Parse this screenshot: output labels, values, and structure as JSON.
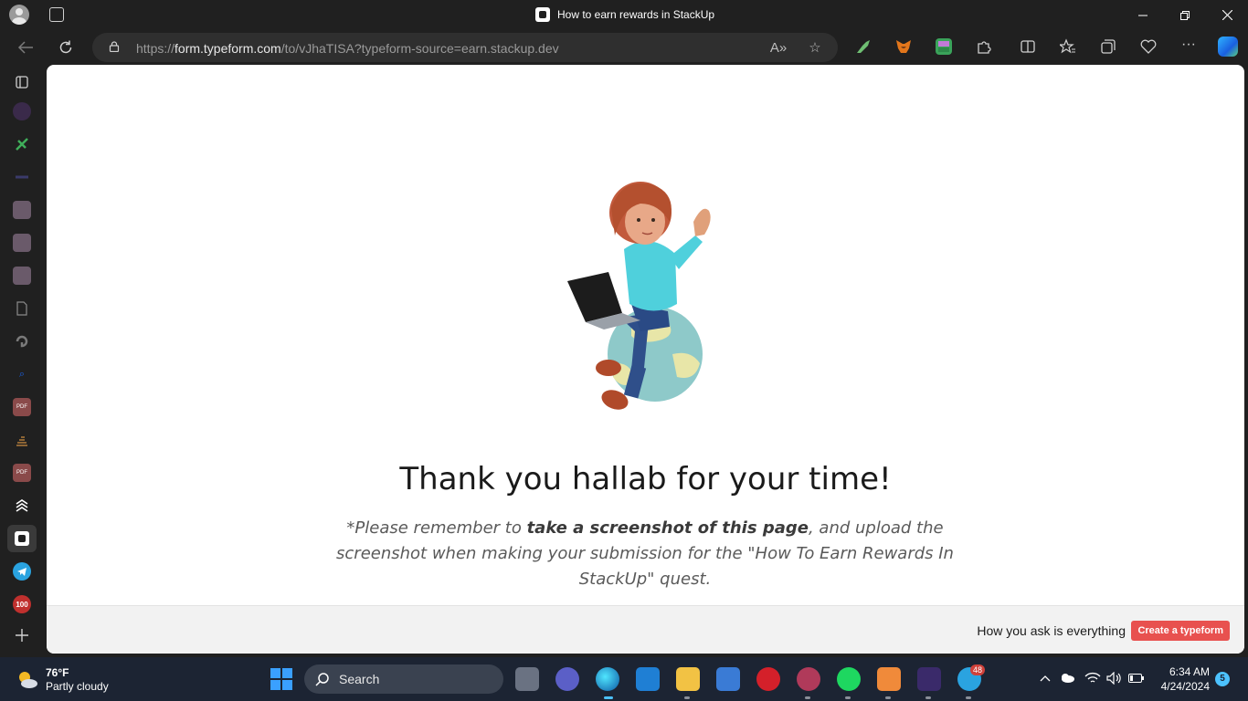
{
  "browser": {
    "tab_title": "How to earn rewards in StackUp",
    "url_host": "form.typeform.com",
    "url_prefix": "https://",
    "url_path": "/to/vJhaTISA?typeform-source=earn.stackup.dev",
    "window_controls": [
      "minimize",
      "restore",
      "close"
    ]
  },
  "page": {
    "heading": "Thank you hallab for your time!",
    "note_prefix": "*Please remember to ",
    "note_bold": "take a screenshot of this page",
    "note_suffix": ", and upload the screenshot when making your submission for the \"How To Earn Rewards In StackUp\" quest.",
    "footer_tagline": "How you ask is everything",
    "footer_button": "Create a typeform"
  },
  "taskbar": {
    "weather_temp": "76°F",
    "weather_desc": "Partly cloudy",
    "search_label": "Search",
    "time": "6:34 AM",
    "date": "4/24/2024",
    "notification_count": "5",
    "telegram_badge": "48"
  },
  "sidebar_badge": "100",
  "colors": {
    "accent_button": "#e8514f",
    "taskbar_bg": "#1c2433",
    "chrome_bg": "#202020"
  }
}
